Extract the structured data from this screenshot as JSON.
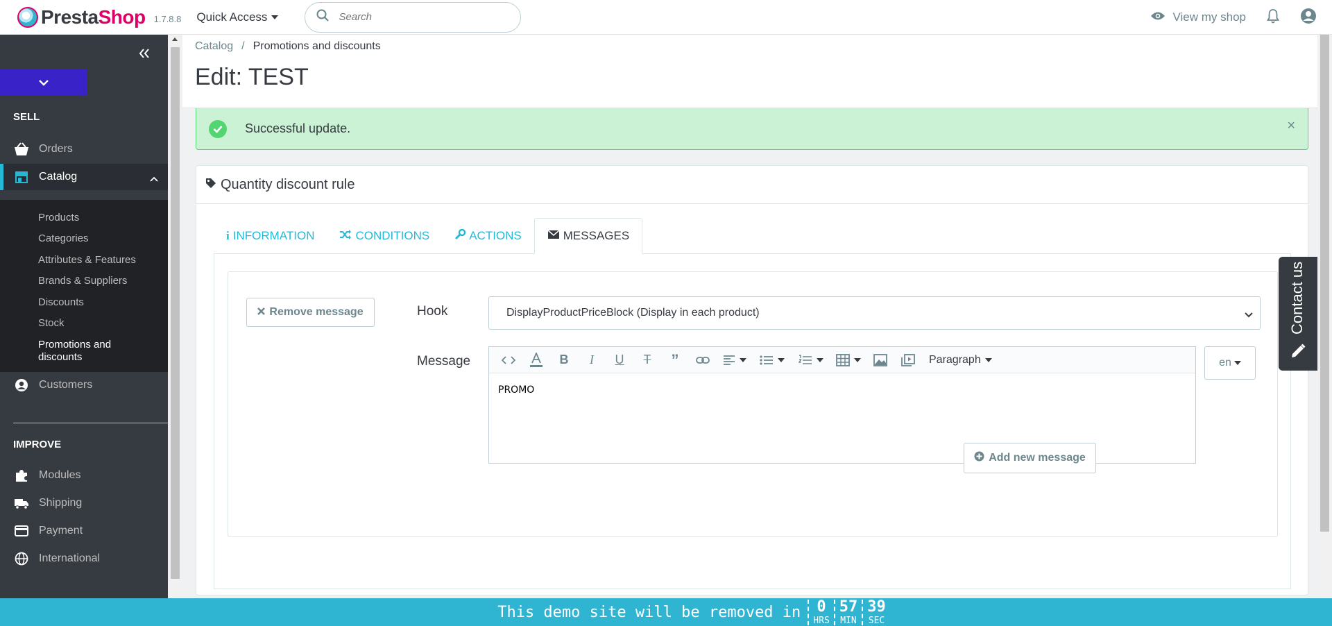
{
  "header": {
    "brand_presta": "Presta",
    "brand_shop": "Shop",
    "version": "1.7.8.8",
    "quick_access": "Quick Access",
    "search_placeholder": "Search",
    "view_shop": "View my shop"
  },
  "sidebar": {
    "sell_title": "SELL",
    "improve_title": "IMPROVE",
    "items": {
      "orders": "Orders",
      "catalog": "Catalog",
      "customers": "Customers",
      "modules": "Modules",
      "shipping": "Shipping",
      "payment": "Payment",
      "international": "International"
    },
    "catalog_sub": {
      "products": "Products",
      "categories": "Categories",
      "attributes": "Attributes & Features",
      "brands": "Brands & Suppliers",
      "discounts": "Discounts",
      "stock": "Stock",
      "promotions_line1": "Promotions and",
      "promotions_line2": "discounts"
    }
  },
  "breadcrumb": {
    "parent": "Catalog",
    "separator": "/",
    "current": "Promotions and discounts"
  },
  "page_title": "Edit: TEST",
  "alert": {
    "message": "Successful update.",
    "close": "×",
    "color": "#cbf2d4"
  },
  "panel": {
    "heading": "Quantity discount rule",
    "tabs": {
      "information": "INFORMATION",
      "conditions": "CONDITIONS",
      "actions": "ACTIONS",
      "messages": "MESSAGES"
    },
    "remove_message": "Remove message",
    "hook_label": "Hook",
    "hook_value": "DisplayProductPriceBlock (Display in each product)",
    "message_label": "Message",
    "editor_content": "PROMO",
    "paragraph_label": "Paragraph",
    "lang": "en",
    "add_message": "Add new message"
  },
  "contact_us": "Contact us",
  "demo_banner": {
    "text": "This demo site will be removed in",
    "hours": "0",
    "hours_unit": "HRS",
    "minutes": "57",
    "minutes_unit": "MIN",
    "seconds": "39",
    "seconds_unit": "SEC"
  },
  "colors": {
    "accent": "#25b9d7",
    "sidebar": "#363a41",
    "brand_pink": "#df0067",
    "banner": "#2fb5d2"
  }
}
